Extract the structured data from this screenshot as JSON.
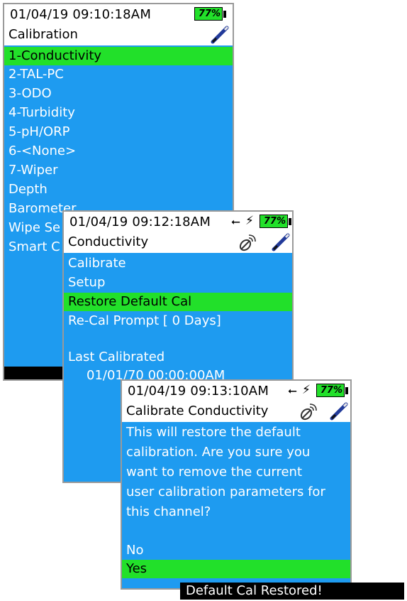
{
  "screen1": {
    "datetime": "01/04/19  09:10:18AM",
    "battery": "77%",
    "title": "Calibration",
    "items": [
      "1-Conductivity",
      "2-TAL-PC",
      "3-ODO",
      "4-Turbidity",
      "5-pH/ORP",
      "6-<None>",
      "7-Wiper",
      "Depth",
      "Barometer",
      "Wipe Se",
      "Smart C"
    ],
    "selected_index": 0
  },
  "screen2": {
    "datetime": "01/04/19  09:12:18AM",
    "battery": "77%",
    "title": "Conductivity",
    "items": [
      "Calibrate",
      "Setup",
      "Restore Default Cal",
      "Re-Cal Prompt [ 0 Days]"
    ],
    "last_cal_label": "Last Calibrated",
    "last_cal_value": "01/01/70 00:00:00AM",
    "selected_index": 2
  },
  "screen3": {
    "datetime": "01/04/19  09:13:10AM",
    "battery": "77%",
    "title": "Calibrate Conductivity",
    "message": [
      "This will restore the default",
      "calibration.  Are you sure you",
      "want to remove the current",
      "user calibration parameters for",
      "this channel?"
    ],
    "options": [
      "No",
      "Yes"
    ],
    "selected_option": 1
  },
  "toast": "Default Cal Restored!",
  "colors": {
    "background": "#1e9bf0",
    "selection": "#22e02a",
    "battery": "#22e02a"
  }
}
